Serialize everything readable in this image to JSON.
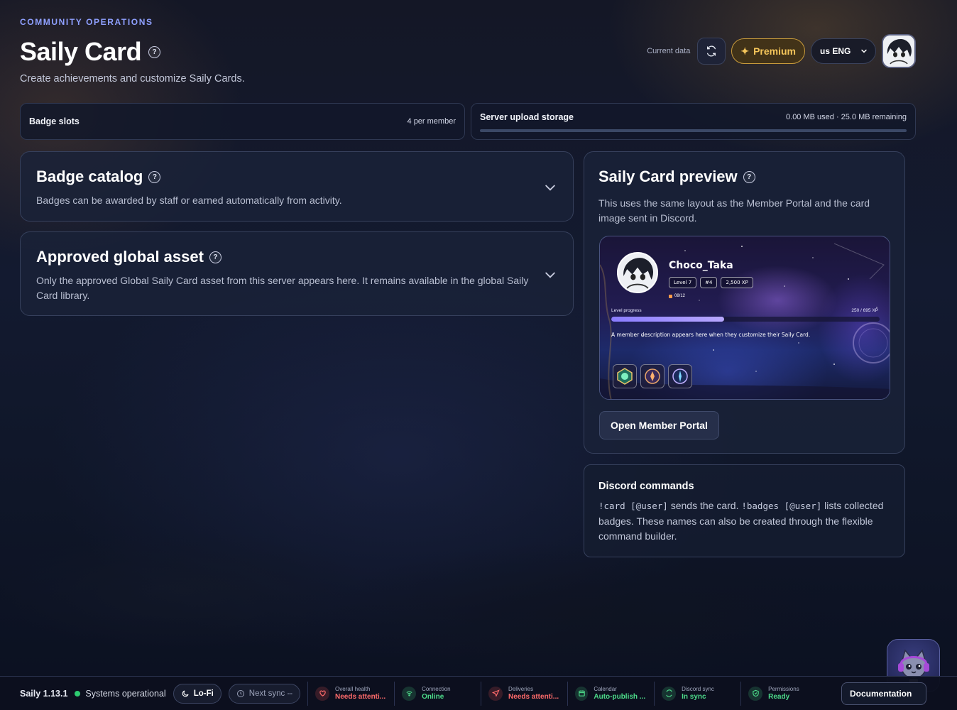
{
  "header": {
    "eyebrow": "COMMUNITY OPERATIONS",
    "title": "Saily Card",
    "subtitle": "Create achievements and customize Saily Cards.",
    "help_glyph": "?"
  },
  "topbar": {
    "current_data_label": "Current data",
    "premium_label": "Premium",
    "language_value": "us ENG"
  },
  "stats": {
    "badge_slots_label": "Badge slots",
    "badge_slots_value": "4 per member",
    "storage_label": "Server upload storage",
    "storage_value": "0.00 MB used · 25.0 MB remaining",
    "storage_used_fraction": 0
  },
  "accordions": [
    {
      "title": "Badge catalog",
      "description": "Badges can be awarded by staff or earned automatically from activity."
    },
    {
      "title": "Approved global asset",
      "description": "Only the approved Global Saily Card asset from this server appears here. It remains available in the global Saily Card library."
    }
  ],
  "preview": {
    "title": "Saily Card preview",
    "description": "This uses the same layout as the Member Portal and the card image sent in Discord.",
    "card": {
      "username": "Choco_Taka",
      "chips": [
        "Level 7",
        "#4",
        "2,500 XP"
      ],
      "date": "08/12",
      "progress_label": "Level progress",
      "progress_xp": "250 / 695 XP",
      "progress_fraction": 0.42,
      "description": "A member description appears here when they customize their Saily Card.",
      "badge_icons": [
        "medal-green-icon",
        "medal-orange-icon",
        "medal-blue-icon"
      ]
    },
    "open_portal_label": "Open Member Portal"
  },
  "commands": {
    "title": "Discord commands",
    "cmd1": "!card [@user]",
    "text1": " sends the card. ",
    "cmd2": "!badges [@user]",
    "text2": " lists collected badges. These names can also be created through the flexible command builder."
  },
  "footer": {
    "version": "Saily 1.13.1",
    "system_status": "Systems operational",
    "lofi_label": "Lo-Fi",
    "next_sync_label": "Next sync --",
    "statuses": [
      {
        "label": "Overall health",
        "value": "Needs attenti...",
        "kind": "warn",
        "icon": "heart-icon"
      },
      {
        "label": "Connection",
        "value": "Online",
        "kind": "ok",
        "icon": "wifi-icon"
      },
      {
        "label": "Deliveries",
        "value": "Needs attenti...",
        "kind": "warn",
        "icon": "send-icon"
      },
      {
        "label": "Calendar",
        "value": "Auto-publish ...",
        "kind": "ok",
        "icon": "calendar-icon"
      },
      {
        "label": "Discord sync",
        "value": "In sync",
        "kind": "ok",
        "icon": "sync-icon"
      },
      {
        "label": "Permissions",
        "value": "Ready",
        "kind": "ok",
        "icon": "shield-icon"
      }
    ],
    "docs_label": "Documentation"
  },
  "colors": {
    "accent": "#8fa0ff",
    "premium": "#f4c55a",
    "warn": "#ff6b6b",
    "ok": "#4ddb8a"
  }
}
